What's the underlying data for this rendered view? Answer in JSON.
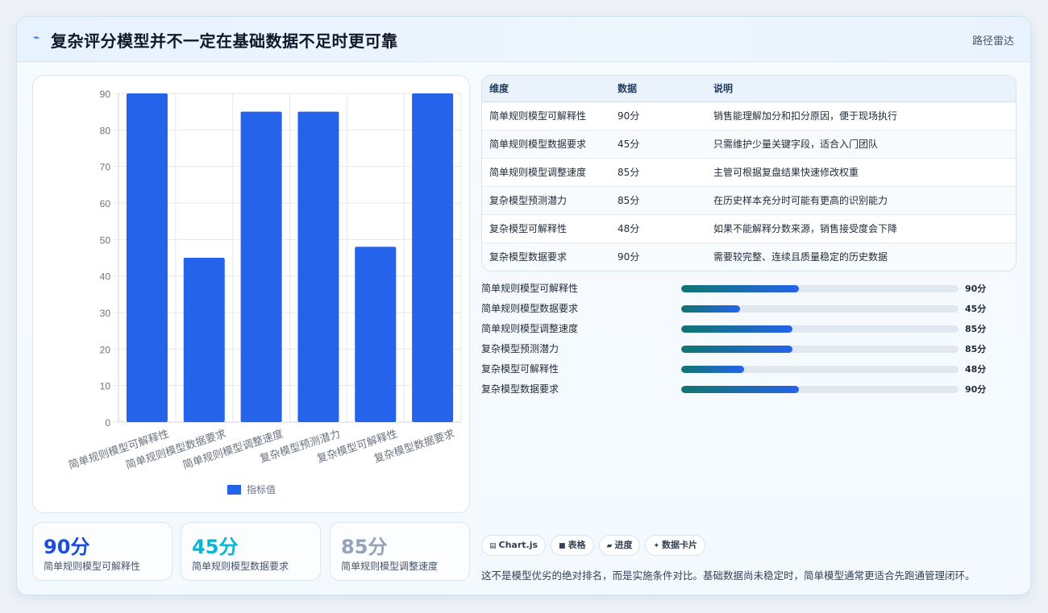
{
  "header": {
    "title": "复杂评分模型并不一定在基础数据不足时更可靠",
    "link": "路径雷达"
  },
  "chart_data": {
    "type": "bar",
    "categories": [
      "简单规则模型可解释性",
      "简单规则模型数据要求",
      "简单规则模型调整速度",
      "复杂模型预测潜力",
      "复杂模型可解释性",
      "复杂模型数据要求"
    ],
    "series": [
      {
        "name": "指标值",
        "values": [
          90,
          45,
          85,
          85,
          48,
          90
        ]
      }
    ],
    "ylim": [
      0,
      90
    ],
    "yticks": [
      0,
      10,
      20,
      30,
      40,
      50,
      60,
      70,
      80,
      90
    ],
    "grid": true,
    "legend": "bottom",
    "color": "#2563eb"
  },
  "stats": [
    {
      "value": "90分",
      "label": "简单规则模型可解释性",
      "color": "#1d4ed8"
    },
    {
      "value": "45分",
      "label": "简单规则模型数据要求",
      "color": "#06b6d4"
    },
    {
      "value": "85分",
      "label": "简单规则模型调整速度",
      "color": "#94a3b8"
    }
  ],
  "table": {
    "headers": [
      "维度",
      "数据",
      "说明"
    ],
    "rows": [
      [
        "简单规则模型可解释性",
        "90分",
        "销售能理解加分和扣分原因，便于现场执行"
      ],
      [
        "简单规则模型数据要求",
        "45分",
        "只需维护少量关键字段，适合入门团队"
      ],
      [
        "简单规则模型调整速度",
        "85分",
        "主管可根据复盘结果快速修改权重"
      ],
      [
        "复杂模型预测潜力",
        "85分",
        "在历史样本充分时可能有更高的识别能力"
      ],
      [
        "复杂模型可解释性",
        "48分",
        "如果不能解释分数来源，销售接受度会下降"
      ],
      [
        "复杂模型数据要求",
        "90分",
        "需要较完整、连续且质量稳定的历史数据"
      ]
    ]
  },
  "progress": [
    {
      "label": "简单规则模型可解释性",
      "value": 90,
      "text": "90分"
    },
    {
      "label": "简单规则模型数据要求",
      "value": 45,
      "text": "45分"
    },
    {
      "label": "简单规则模型调整速度",
      "value": 85,
      "text": "85分"
    },
    {
      "label": "复杂模型预测潜力",
      "value": 85,
      "text": "85分"
    },
    {
      "label": "复杂模型可解释性",
      "value": 48,
      "text": "48分"
    },
    {
      "label": "复杂模型数据要求",
      "value": 90,
      "text": "90分"
    }
  ],
  "progress_max": 212,
  "chips": [
    {
      "icon": "chart-icon",
      "glyph": "▤",
      "label": "Chart.js"
    },
    {
      "icon": "table-icon",
      "glyph": "■",
      "label": "表格"
    },
    {
      "icon": "progress-icon",
      "glyph": "▰",
      "label": "进度"
    },
    {
      "icon": "card-icon",
      "glyph": "✦",
      "label": "数据卡片"
    }
  ],
  "note": "这不是模型优劣的绝对排名，而是实施条件对比。基础数据尚未稳定时，简单模型通常更适合先跑通管理闭环。"
}
